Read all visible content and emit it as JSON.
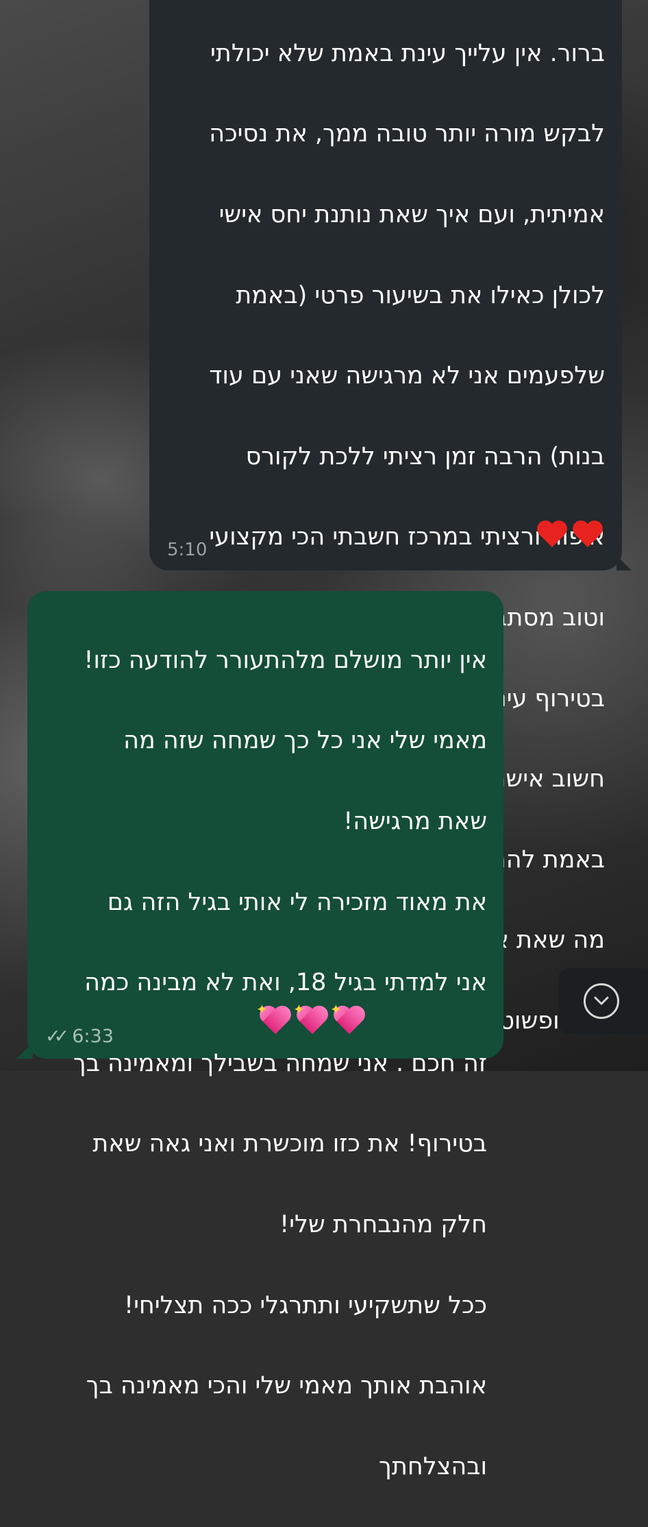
{
  "incoming_message": {
    "lines": [
      "ברור. אין עלייך עינת באמת שלא יכולתי",
      "לבקש מורה יותר טובה ממך, את נסיכה",
      "אמיתית, ועם איך שאת נותנת יחס אישי",
      "לכולן כאילו את בשיעור פרטי (באמת",
      "שלפעמים אני לא מרגישה שאני עם עוד",
      "בנות) הרבה זמן רציתי ללכת לקורס",
      "איפור ורציתי במרכז חשבתי הכי מקצועי",
      "וטוב מסתבר שלא. את באמת מוכשרת",
      "בטירוף עינת את מפסלת מדהים והכי",
      "חשוב אישה עם לב זהב. מאחלת לך",
      "באמת להמשיך ולהצליח ורק לעשות את",
      "מה שאת אוהבת כי את באמת הכי טובה",
      "בזה ופשוט רואים שנולדת לעשות את זה."
    ],
    "emoji": [
      "red-heart",
      "red-heart"
    ],
    "time": "5:10"
  },
  "outgoing_message": {
    "lines": [
      "אין יותר מושלם מלהתעורר להודעה כזו!",
      "מאמי שלי אני כל כך שמחה שזה מה",
      "שאת מרגישה!",
      "את מאוד מזכירה לי אותי בגיל הזה גם",
      "אני למדתי בגיל 18, ואת לא מבינה כמה",
      "זה חכם . אני שמחה בשבילך ומאמינה בך",
      "בטירוף! את כזו מוכשרת ואני גאה שאת",
      "חלק מהנבחרת שלי!",
      "ככל שתשקיעי ותתרגלי ככה תצליחי!",
      "אוהבת אותך מאמי שלי והכי מאמינה בך",
      "ובהצלחתך"
    ],
    "emoji": [
      "sparkling-heart",
      "sparkling-heart",
      "sparkling-heart"
    ],
    "time": "6:33",
    "status": "read"
  },
  "colors": {
    "incoming_bubble": "#23292c",
    "outgoing_bubble": "#144d38",
    "text": "#ffffff"
  }
}
